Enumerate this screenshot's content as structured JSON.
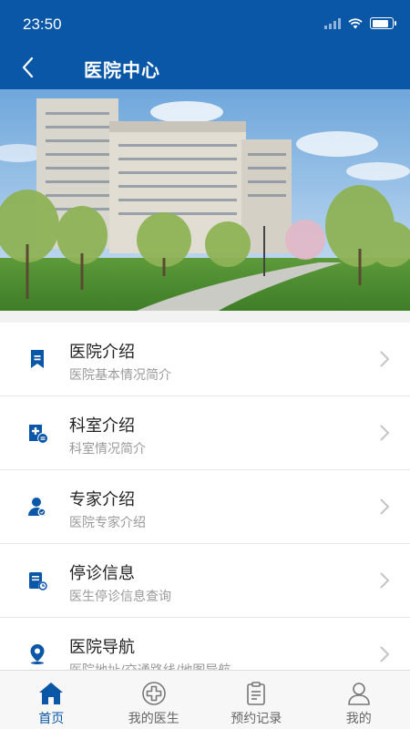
{
  "status_bar": {
    "time": "23:50",
    "battery_level": 0.85
  },
  "nav": {
    "title": "医院中心"
  },
  "colors": {
    "primary": "#0a57a8",
    "subtitle": "#9a9a9a",
    "tab_inactive": "#666666"
  },
  "menu": [
    {
      "title": "医院介绍",
      "subtitle": "医院基本情况简介",
      "icon": "bookmark-icon"
    },
    {
      "title": "科室介绍",
      "subtitle": "科室情况简介",
      "icon": "medical-doc-icon"
    },
    {
      "title": "专家介绍",
      "subtitle": "医院专家介绍",
      "icon": "doctor-icon"
    },
    {
      "title": "停诊信息",
      "subtitle": "医生停诊信息查询",
      "icon": "schedule-icon"
    },
    {
      "title": "医院导航",
      "subtitle": "医院地址/交通路线/地图导航",
      "icon": "location-pin-icon"
    }
  ],
  "tabs": [
    {
      "label": "首页",
      "icon": "home-icon",
      "active": true
    },
    {
      "label": "我的医生",
      "icon": "medical-cross-icon",
      "active": false
    },
    {
      "label": "预约记录",
      "icon": "clipboard-icon",
      "active": false
    },
    {
      "label": "我的",
      "icon": "person-icon",
      "active": false
    }
  ]
}
